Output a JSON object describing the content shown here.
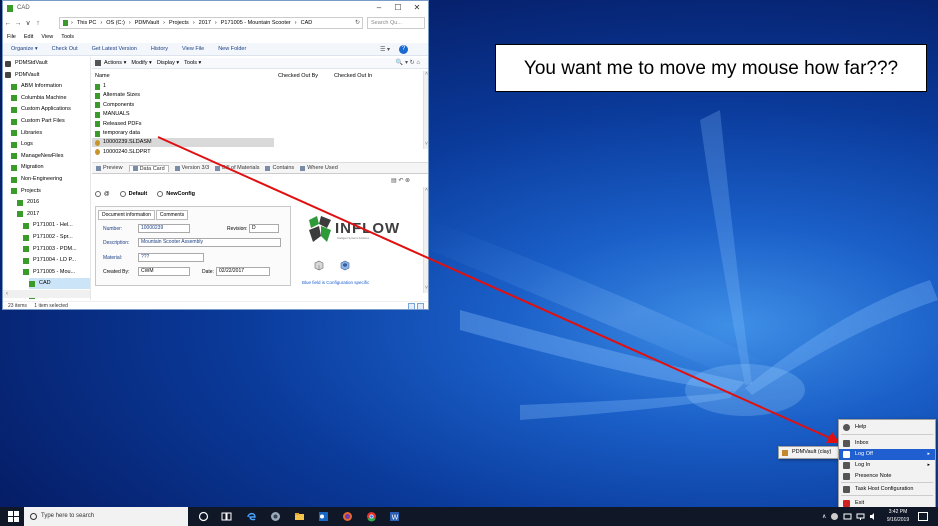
{
  "window": {
    "title": "CAD",
    "minimize": "–",
    "maximize": "☐",
    "close": "✕",
    "nav_back": "←",
    "nav_forward": "→",
    "nav_history": "∨",
    "nav_up": "↑",
    "address": {
      "crumbs": [
        "›",
        "This PC",
        "›",
        "OS (C:)",
        "›",
        "PDMVault",
        "›",
        "Projects",
        "›",
        "2017",
        "›",
        "P171005 - Mountain Scooter",
        "›",
        "CAD"
      ],
      "refresh": "↻",
      "search_placeholder": "Search Qu..."
    },
    "menu": [
      "File",
      "Edit",
      "View",
      "Tools"
    ],
    "commands": [
      "Organize ▾",
      "Check Out",
      "Get Latest Version",
      "History",
      "View File",
      "New Folder"
    ],
    "view_select": "☰ ▾",
    "help": "?"
  },
  "tree": {
    "items": [
      {
        "label": "PDMStdVault",
        "icon": "vault",
        "indent": 1
      },
      {
        "label": "PDMVault",
        "icon": "vault",
        "indent": 1
      },
      {
        "label": "ABM Information",
        "icon": "folder",
        "indent": 2
      },
      {
        "label": "Columbia Machine",
        "icon": "folder",
        "indent": 2
      },
      {
        "label": "Custom Applications",
        "icon": "folder",
        "indent": 2
      },
      {
        "label": "Custom Part Files",
        "icon": "folder",
        "indent": 2
      },
      {
        "label": "Libraries",
        "icon": "folder",
        "indent": 2
      },
      {
        "label": "Logs",
        "icon": "folder",
        "indent": 2
      },
      {
        "label": "ManageNewFiles",
        "icon": "folder",
        "indent": 2
      },
      {
        "label": "Migration",
        "icon": "folder",
        "indent": 2
      },
      {
        "label": "Non-Engineering",
        "icon": "folder",
        "indent": 2
      },
      {
        "label": "Projects",
        "icon": "folder",
        "indent": 2
      },
      {
        "label": "2016",
        "icon": "folder",
        "indent": 3
      },
      {
        "label": "2017",
        "icon": "folder",
        "indent": 3
      },
      {
        "label": "P171001 - Hel...",
        "icon": "folder",
        "indent": 4
      },
      {
        "label": "P171002 - Spr...",
        "icon": "folder",
        "indent": 4
      },
      {
        "label": "P171003 - PDM...",
        "icon": "folder",
        "indent": 4
      },
      {
        "label": "P171004 - LD P...",
        "icon": "folder",
        "indent": 4
      },
      {
        "label": "P171005 - Mou...",
        "icon": "folder",
        "indent": 4
      },
      {
        "label": "CAD",
        "icon": "folder",
        "indent": 5,
        "selected": true
      },
      {
        "label": "Support Doc...",
        "icon": "folder",
        "indent": 5
      }
    ],
    "hscroll_left": "‹",
    "hscroll_right": "›"
  },
  "files": {
    "toolbar": [
      "Actions ▾",
      "Modify ▾",
      "Display ▾",
      "Tools ▾"
    ],
    "toolbar_right": "🔍 ▾ ↻ ⌂",
    "columns": [
      "Name",
      "Checked Out By",
      "Checked Out In"
    ],
    "rows": [
      {
        "name": "1",
        "type": "folder"
      },
      {
        "name": "Alternate Sizes",
        "type": "folder"
      },
      {
        "name": "Components",
        "type": "folder"
      },
      {
        "name": "MANUALS",
        "type": "folder"
      },
      {
        "name": "Released PDFs",
        "type": "folder"
      },
      {
        "name": "temporary data",
        "type": "folder"
      },
      {
        "name": "10000239.SLDASM",
        "type": "assembly",
        "selected": true
      },
      {
        "name": "10000240.SLDPRT",
        "type": "part"
      }
    ],
    "scroll_up": "˄",
    "scroll_down": "˅"
  },
  "tabs": [
    "Preview",
    "Data Card",
    "Version 3/3",
    "Bill of Materials",
    "Contains",
    "Where Used"
  ],
  "pane_tools": "▤  ↶  ⊗",
  "configs": [
    {
      "label": "@",
      "bold": false
    },
    {
      "label": "Default",
      "bold": true
    },
    {
      "label": "NewConfig",
      "bold": true
    }
  ],
  "datacard": {
    "tabs": [
      "Document information",
      "Comments"
    ],
    "number_label": "Number:",
    "number": "10000239",
    "revision_label": "Revision:",
    "revision": "D",
    "description_label": "Description:",
    "description": "Mountain Scooter Assembly",
    "material_label": "Material:",
    "material": "???",
    "created_by_label": "Created By:",
    "created_by": "CWM",
    "date_label": "Date:",
    "date": "02/22/2017",
    "logo_text": "INFLOW",
    "logo_sub": "Intelligent Systems Solutions",
    "config_link": "Blue field is Configuration specific"
  },
  "status": {
    "items": "23 items",
    "selected": "1 item selected"
  },
  "speech": "You want me to move my mouse how far???",
  "tray_menu": {
    "items": [
      {
        "label": "Help",
        "icon": "help-icon"
      },
      {
        "label": "Inbox",
        "icon": "inbox-icon"
      },
      {
        "label": "Log Off",
        "icon": "logoff-icon",
        "highlight": true,
        "arrow": true
      },
      {
        "label": "Log In",
        "icon": "login-icon",
        "arrow": true
      },
      {
        "label": "Presence Note",
        "icon": "note-icon"
      },
      {
        "label": "Task Host Configuration",
        "icon": "task-icon"
      },
      {
        "label": "Exit",
        "icon": "exit-icon"
      }
    ],
    "arrow": "▸",
    "submenu": "PDMVault (clay)"
  },
  "taskbar": {
    "search_placeholder": "Type here to search",
    "tray_up": "∧",
    "clock_time": "3:42 PM",
    "clock_date": "9/16/2019"
  },
  "colors": {
    "accent": "#1f5fd0",
    "arrow": "#e01010",
    "folder": "#3a9a2a"
  }
}
